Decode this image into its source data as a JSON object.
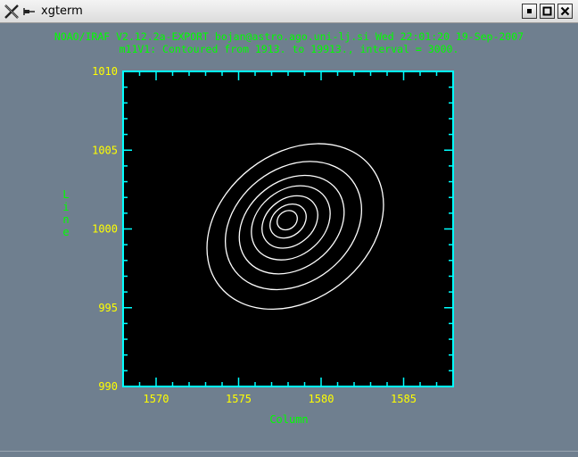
{
  "window": {
    "title": "xgterm",
    "buttons": {
      "minimize": "minimize-icon",
      "maximize": "maximize-icon",
      "close": "close-icon"
    }
  },
  "header": {
    "line1": "NOAO/IRAF V2.12.2a-EXPORT bojan@astro.ago.uni-lj.si Wed 22:01:20 19-Sep-2007",
    "line2": "m11V1: Contoured from 1913. to 19913., interval = 3000."
  },
  "colors": {
    "background": "#6f7f8f",
    "plot_background": "#000000",
    "frame": "#00ffff",
    "tick_labels": "#ffff00",
    "header_text": "#00ff00",
    "contours": "#ffffff"
  },
  "chart_data": {
    "type": "contour",
    "xlabel": "Column",
    "ylabel": "Line",
    "xlim": [
      1568,
      1588
    ],
    "ylim": [
      990,
      1010
    ],
    "x_ticks": [
      "1570",
      "1575",
      "1580",
      "1585"
    ],
    "y_ticks": [
      "990",
      "995",
      "1000",
      "1005",
      "1010"
    ],
    "contour_min": 1913,
    "contour_max": 19913,
    "interval": 3000,
    "levels": [
      1913,
      4913,
      7913,
      10913,
      13913,
      16913,
      19913
    ],
    "peak": {
      "x": 1578,
      "y": 1000.5
    }
  }
}
